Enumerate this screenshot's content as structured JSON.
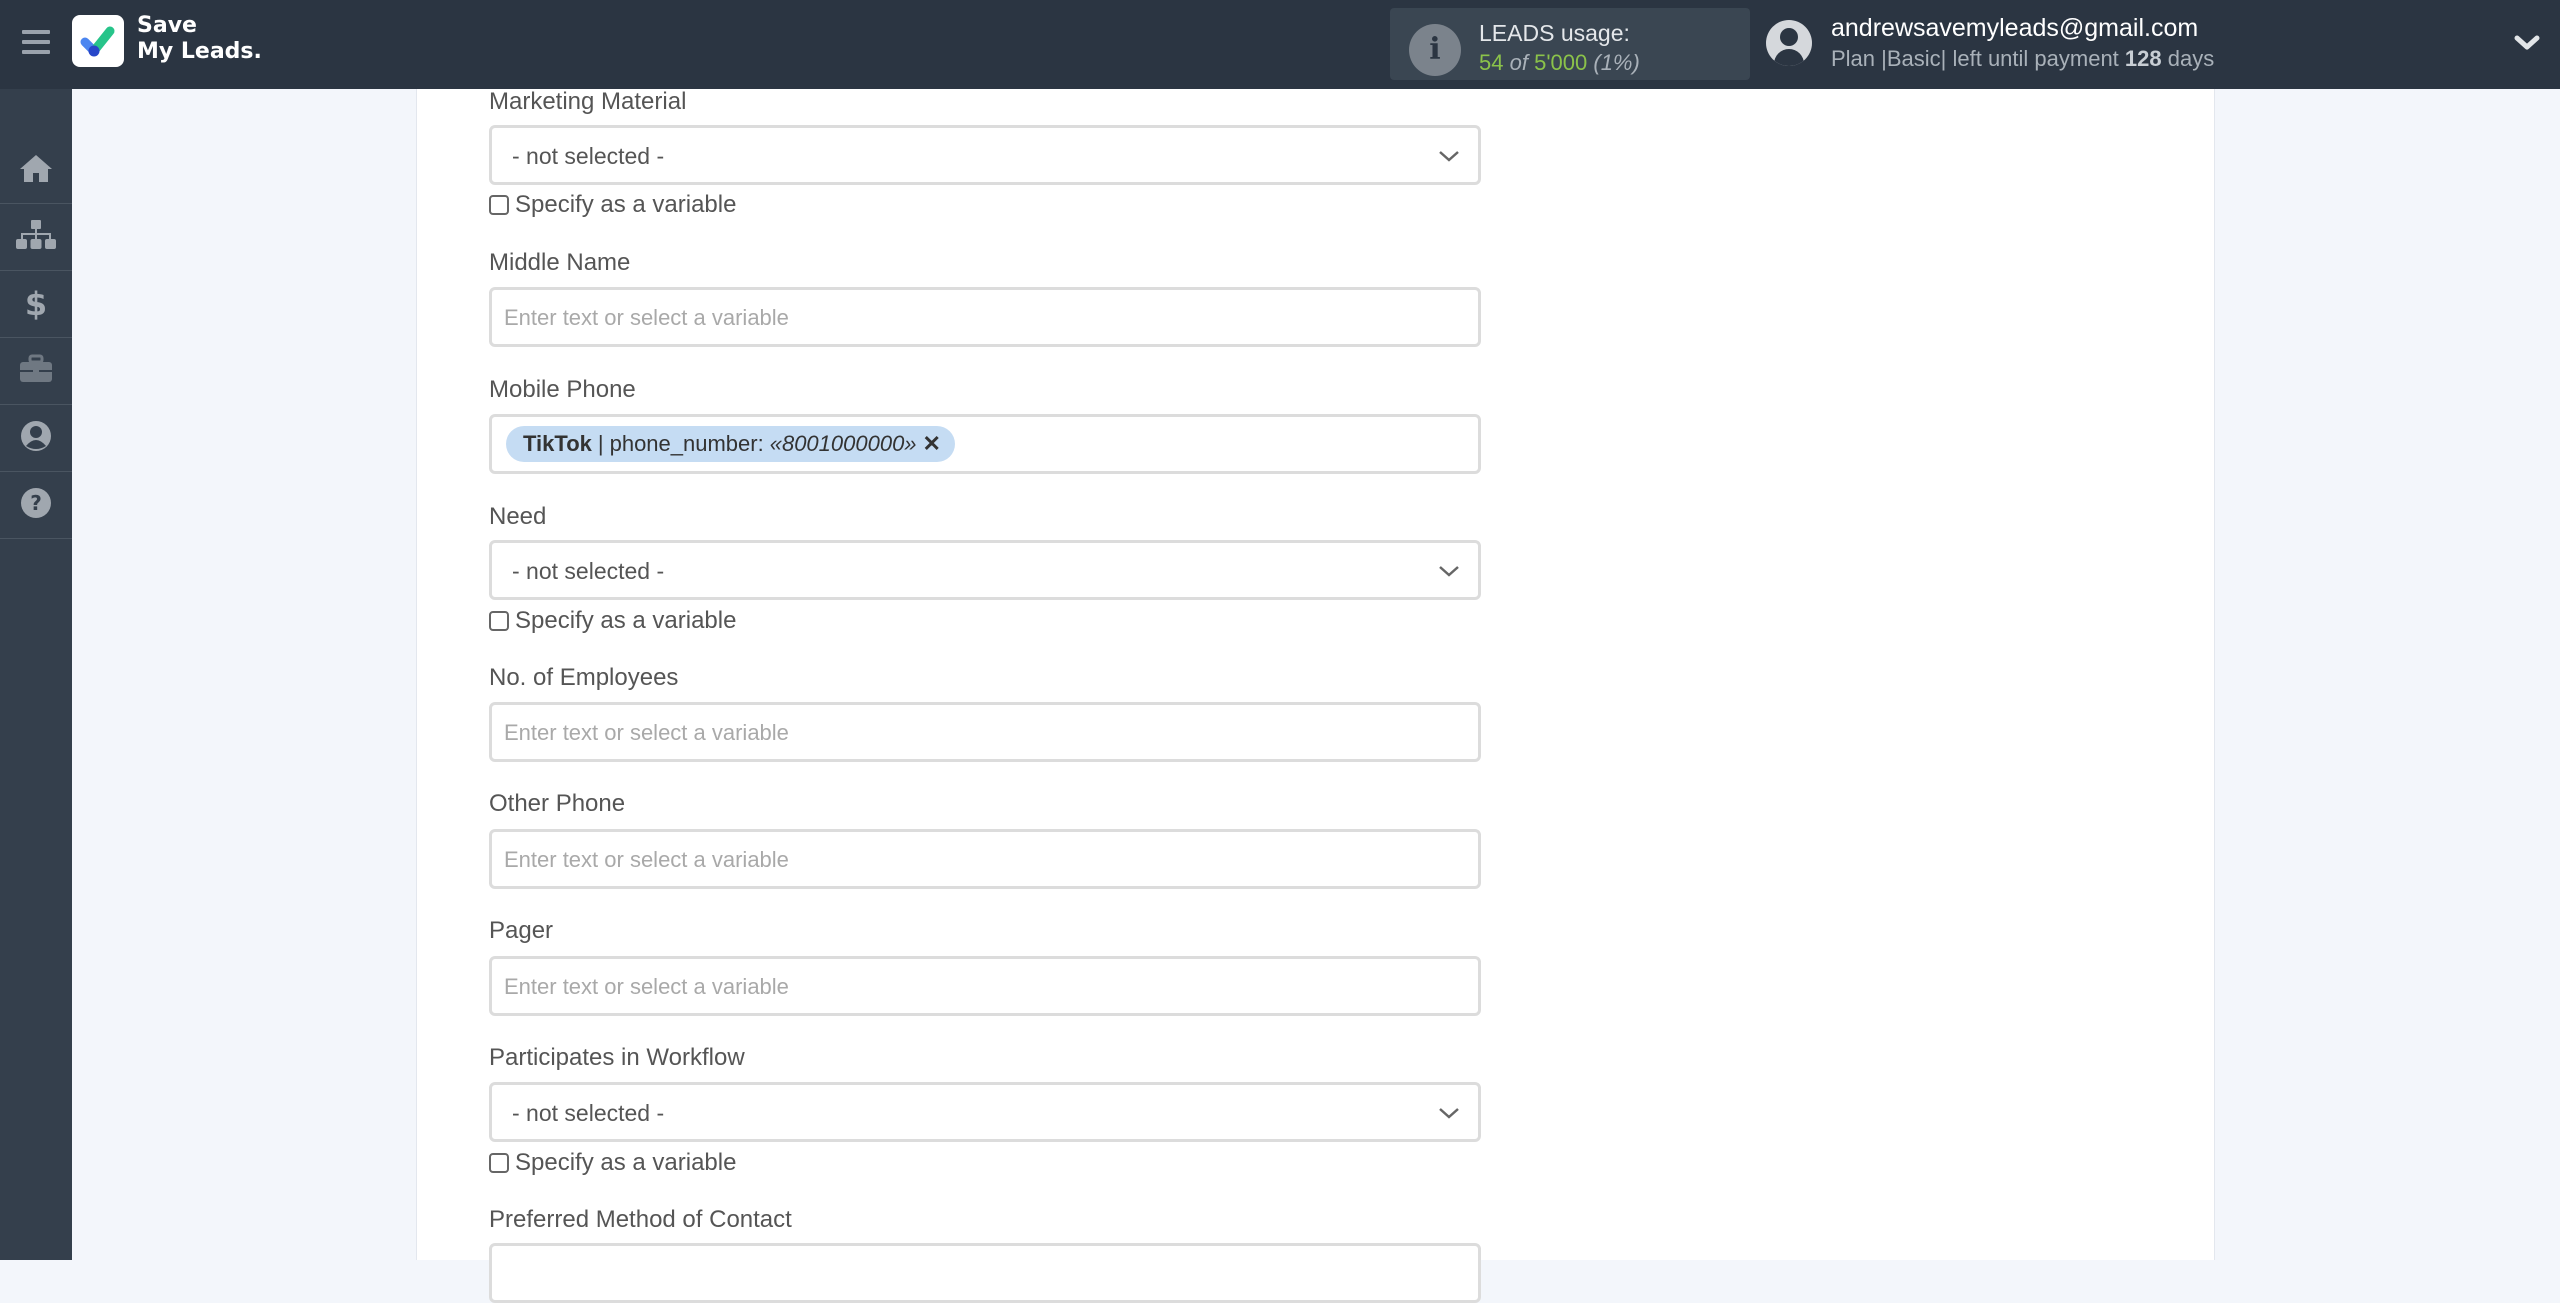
{
  "header": {
    "brand_line1": "Save",
    "brand_line2": "My Leads.",
    "usage": {
      "title": "LEADS usage:",
      "used": "54",
      "of_label": "of",
      "limit": "5'000",
      "percent": "(1%)"
    },
    "user": {
      "email": "andrewsavemyleads@gmail.com",
      "plan_prefix": "Plan |Basic| left until payment",
      "days": "128",
      "days_suffix": "days"
    }
  },
  "sidebar": {
    "items": [
      {
        "name": "home",
        "icon": "home-icon"
      },
      {
        "name": "connections",
        "icon": "sitemap-icon"
      },
      {
        "name": "billing",
        "icon": "dollar-icon"
      },
      {
        "name": "tools",
        "icon": "briefcase-icon"
      },
      {
        "name": "account",
        "icon": "user-circle-icon"
      },
      {
        "name": "help",
        "icon": "question-circle-icon"
      }
    ]
  },
  "form": {
    "placeholder": "Enter text or select a variable",
    "not_selected": "- not selected -",
    "variable_label": "Specify as a variable",
    "fields": {
      "marketing_material": {
        "label": "Marketing Material",
        "value": "- not selected -",
        "as_variable": false
      },
      "middle_name": {
        "label": "Middle Name",
        "value": ""
      },
      "mobile_phone": {
        "label": "Mobile Phone",
        "tag": {
          "source": "TikTok",
          "separator": "|",
          "field": "phone_number:",
          "value": "«8001000000»",
          "remove": "✕"
        }
      },
      "need": {
        "label": "Need",
        "value": "- not selected -",
        "as_variable": false
      },
      "no_of_employees": {
        "label": "No. of Employees",
        "value": ""
      },
      "other_phone": {
        "label": "Other Phone",
        "value": ""
      },
      "pager": {
        "label": "Pager",
        "value": ""
      },
      "participates_in_workflow": {
        "label": "Participates in Workflow",
        "value": "- not selected -",
        "as_variable": false
      },
      "preferred_method_of_contact": {
        "label": "Preferred Method of Contact"
      }
    }
  }
}
